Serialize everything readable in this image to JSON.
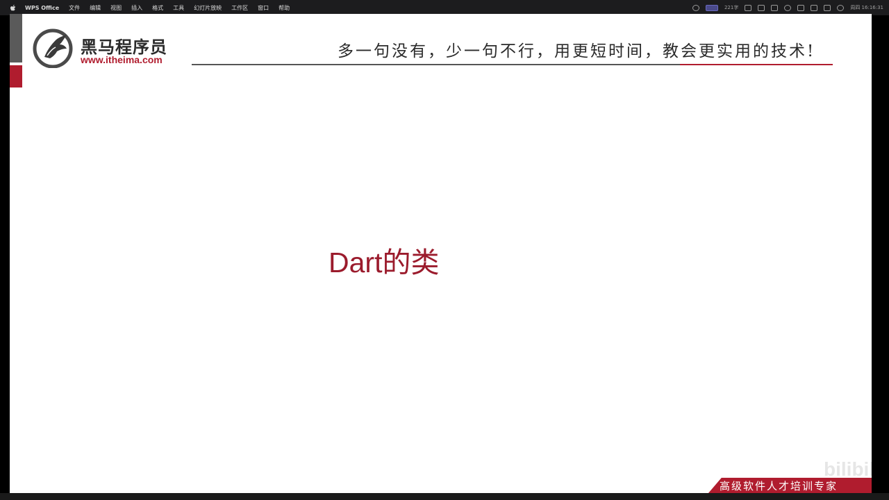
{
  "menubar": {
    "app_name": "WPS Office",
    "items": [
      "文件",
      "编辑",
      "视图",
      "插入",
      "格式",
      "工具",
      "幻灯片放映",
      "工作区",
      "窗口",
      "帮助"
    ],
    "status_text": "221字",
    "clock": "周四 16:16:31"
  },
  "slide": {
    "brand_name": "黑马程序员",
    "brand_url": "www.itheima.com",
    "slogan": "多一句没有，少一句不行，用更短时间，教会更实用的技术!",
    "title": "Dart的类",
    "footer": "高级软件人才培训专家",
    "watermark": "bilibili",
    "colors": {
      "accent_red": "#b01c2e",
      "title_red": "#9b1b2c",
      "sidebar_gray": "#5a5a5a"
    }
  }
}
